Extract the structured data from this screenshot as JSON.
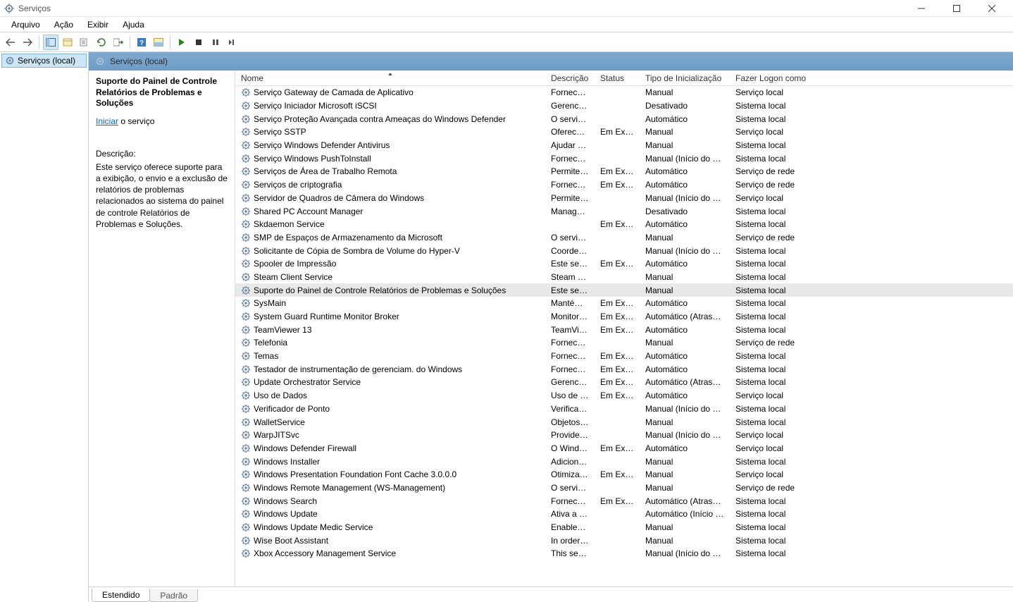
{
  "window": {
    "title": "Serviços"
  },
  "menu": [
    "Arquivo",
    "Ação",
    "Exibir",
    "Ajuda"
  ],
  "tree": {
    "root": "Serviços (local)"
  },
  "content_header": "Serviços (local)",
  "detail": {
    "selected_name": "Suporte do Painel de Controle Relatórios de Problemas e Soluções",
    "action_link": "Iniciar",
    "action_suffix": " o serviço",
    "desc_label": "Descrição:",
    "desc_text": "Este serviço oferece suporte para a exibição, o envio e a exclusão de relatórios de problemas relacionados ao sistema do painel de controle Relatórios de Problemas e Soluções."
  },
  "columns": {
    "name": "Nome",
    "desc": "Descrição",
    "status": "Status",
    "start": "Tipo de Inicialização",
    "logon": "Fazer Logon como"
  },
  "tabs": {
    "extended": "Estendido",
    "standard": "Padrão"
  },
  "services": [
    {
      "name": "Serviço Gateway de Camada de Aplicativo",
      "desc": "Fornece s...",
      "status": "",
      "start": "Manual",
      "logon": "Serviço local"
    },
    {
      "name": "Serviço Iniciador Microsoft iSCSI",
      "desc": "Gerencia a...",
      "status": "",
      "start": "Desativado",
      "logon": "Sistema local"
    },
    {
      "name": "Serviço Proteção Avançada contra Ameaças do Windows Defender",
      "desc": "O serviço ...",
      "status": "",
      "start": "Automático",
      "logon": "Sistema local"
    },
    {
      "name": "Serviço SSTP",
      "desc": "Oferece s...",
      "status": "Em Exe...",
      "start": "Manual",
      "logon": "Serviço local"
    },
    {
      "name": "Serviço Windows Defender Antivirus",
      "desc": "Ajudar a p...",
      "status": "",
      "start": "Manual",
      "logon": "Sistema local"
    },
    {
      "name": "Serviço Windows PushToInstall",
      "desc": "Fornece s...",
      "status": "",
      "start": "Manual (Início do Ga...",
      "logon": "Sistema local"
    },
    {
      "name": "Serviços de Área de Trabalho Remota",
      "desc": "Permite q...",
      "status": "Em Exe...",
      "start": "Automático",
      "logon": "Serviço de rede"
    },
    {
      "name": "Serviços de criptografia",
      "desc": "Fornece tr...",
      "status": "Em Exe...",
      "start": "Automático",
      "logon": "Serviço de rede"
    },
    {
      "name": "Servidor de Quadros de Câmera do Windows",
      "desc": "Permite q...",
      "status": "",
      "start": "Manual (Início do Ga...",
      "logon": "Serviço local"
    },
    {
      "name": "Shared PC Account Manager",
      "desc": "Manages ...",
      "status": "",
      "start": "Desativado",
      "logon": "Sistema local"
    },
    {
      "name": "Skdaemon Service",
      "desc": "",
      "status": "Em Exe...",
      "start": "Automático",
      "logon": "Sistema local"
    },
    {
      "name": "SMP de Espaços de Armazenamento da Microsoft",
      "desc": "O serviço ...",
      "status": "",
      "start": "Manual",
      "logon": "Serviço de rede"
    },
    {
      "name": "Solicitante de Cópia de Sombra de Volume do Hyper-V",
      "desc": "Coordena ...",
      "status": "",
      "start": "Manual (Início do Ga...",
      "logon": "Sistema local"
    },
    {
      "name": "Spooler de Impressão",
      "desc": "Este serviç...",
      "status": "Em Exe...",
      "start": "Automático",
      "logon": "Sistema local"
    },
    {
      "name": "Steam Client Service",
      "desc": "Steam Cli...",
      "status": "",
      "start": "Manual",
      "logon": "Sistema local"
    },
    {
      "name": "Suporte do Painel de Controle Relatórios de Problemas e Soluções",
      "desc": "Este serviç...",
      "status": "",
      "start": "Manual",
      "logon": "Sistema local",
      "selected": true
    },
    {
      "name": "SysMain",
      "desc": "Mantém e...",
      "status": "Em Exe...",
      "start": "Automático",
      "logon": "Sistema local"
    },
    {
      "name": "System Guard Runtime Monitor Broker",
      "desc": "Monitora ...",
      "status": "Em Exe...",
      "start": "Automático (Atraso ...",
      "logon": "Sistema local"
    },
    {
      "name": "TeamViewer 13",
      "desc": "TeamView...",
      "status": "Em Exe...",
      "start": "Automático",
      "logon": "Sistema local"
    },
    {
      "name": "Telefonia",
      "desc": "Fornece s...",
      "status": "",
      "start": "Manual",
      "logon": "Serviço de rede"
    },
    {
      "name": "Temas",
      "desc": "Fornece g...",
      "status": "Em Exe...",
      "start": "Automático",
      "logon": "Sistema local"
    },
    {
      "name": "Testador de instrumentação de gerenciam. do Windows",
      "desc": "Fornece u...",
      "status": "Em Exe...",
      "start": "Automático",
      "logon": "Sistema local"
    },
    {
      "name": "Update Orchestrator Service",
      "desc": "Gerencia ...",
      "status": "Em Exe...",
      "start": "Automático (Atraso ...",
      "logon": "Sistema local"
    },
    {
      "name": "Uso de Dados",
      "desc": "Uso de da...",
      "status": "Em Exe...",
      "start": "Automático",
      "logon": "Serviço local"
    },
    {
      "name": "Verificador de Ponto",
      "desc": "Verifica po...",
      "status": "",
      "start": "Manual (Início do Ga...",
      "logon": "Sistema local"
    },
    {
      "name": "WalletService",
      "desc": "Objetos d...",
      "status": "",
      "start": "Manual",
      "logon": "Sistema local"
    },
    {
      "name": "WarpJITSvc",
      "desc": "Provides a...",
      "status": "",
      "start": "Manual (Início do Ga...",
      "logon": "Serviço local"
    },
    {
      "name": "Windows Defender Firewall",
      "desc": "O Windo...",
      "status": "Em Exe...",
      "start": "Automático",
      "logon": "Serviço local"
    },
    {
      "name": "Windows Installer",
      "desc": "Adiciona, ...",
      "status": "",
      "start": "Manual",
      "logon": "Sistema local"
    },
    {
      "name": "Windows Presentation Foundation Font Cache 3.0.0.0",
      "desc": "Otimiza o ...",
      "status": "Em Exe...",
      "start": "Manual",
      "logon": "Serviço local"
    },
    {
      "name": "Windows Remote Management (WS-Management)",
      "desc": "O serviço ...",
      "status": "",
      "start": "Manual",
      "logon": "Serviço de rede"
    },
    {
      "name": "Windows Search",
      "desc": "Fornece in...",
      "status": "Em Exe...",
      "start": "Automático (Atraso ...",
      "logon": "Sistema local"
    },
    {
      "name": "Windows Update",
      "desc": "Ativa a de...",
      "status": "",
      "start": "Automático (Início d...",
      "logon": "Sistema local"
    },
    {
      "name": "Windows Update Medic Service",
      "desc": "Enables re...",
      "status": "",
      "start": "Manual",
      "logon": "Sistema local"
    },
    {
      "name": "Wise Boot Assistant",
      "desc": "In order to...",
      "status": "",
      "start": "Manual",
      "logon": "Sistema local"
    },
    {
      "name": "Xbox Accessory Management Service",
      "desc": "This servic...",
      "status": "",
      "start": "Manual (Início do Ga...",
      "logon": "Sistema local"
    }
  ]
}
